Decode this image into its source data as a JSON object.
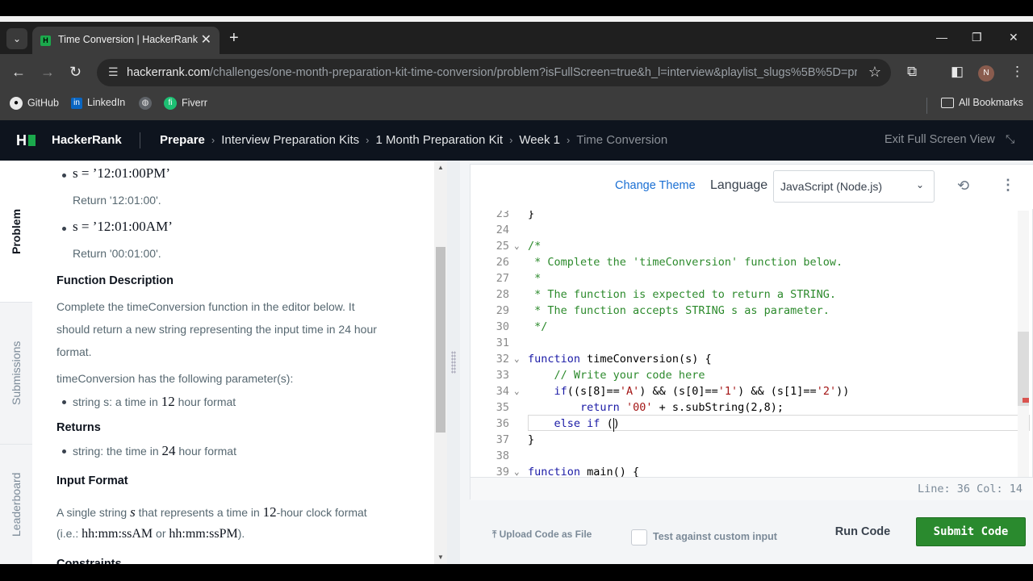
{
  "browser": {
    "tab_title": "Time Conversion | HackerRank",
    "tab_favicon": "H",
    "url_domain": "hackerrank.com",
    "url_path": "/challenges/one-month-preparation-kit-time-conversion/problem?isFullScreen=true&h_l=interview&playlist_slugs%5B%5D=prep...",
    "profile_initial": "N",
    "bookmarks": [
      "GitHub",
      "LinkedIn",
      "",
      "Fiverr"
    ],
    "all_bookmarks": "All Bookmarks"
  },
  "header": {
    "logo": "H",
    "brand": "HackerRank",
    "breadcrumbs": [
      "Prepare",
      "Interview Preparation Kits",
      "1 Month Preparation Kit",
      "Week 1",
      "Time Conversion"
    ],
    "exit_fullscreen": "Exit Full Screen View"
  },
  "side_tabs": [
    "Problem",
    "Submissions",
    "Leaderboard"
  ],
  "problem": {
    "ex1_code": "s = ’12:01:00PM’",
    "ex1_return": "Return '12:01:00'.",
    "ex2_code": "s = ’12:01:00AM’",
    "ex2_return": "Return '00:01:00'.",
    "func_desc_heading": "Function Description",
    "func_desc_line1": "Complete the timeConversion function in the editor below. It",
    "func_desc_line2": "should return a new string representing the input time in 24 hour",
    "func_desc_line3": "format.",
    "params_line": "timeConversion has the following parameter(s):",
    "param_text_a": "string s: a time in ",
    "param_num": "12",
    "param_text_b": " hour format",
    "returns_heading": "Returns",
    "returns_text_a": "string: the time in ",
    "returns_num": "24",
    "returns_text_b": " hour format",
    "input_heading": "Input Format",
    "input_text_a": "A single string ",
    "input_var": "s",
    "input_text_b": " that represents a time in ",
    "input_num": "12",
    "input_text_c": "-hour clock format",
    "ie_open": "(i.e.: ",
    "ie_fmt1": "hh:mm:ssAM",
    "ie_or": " or ",
    "ie_fmt2": "hh:mm:ssPM",
    "ie_close": ").",
    "constraints_heading": "Constraints"
  },
  "editor": {
    "change_theme": "Change Theme",
    "language_label": "Language",
    "language": "JavaScript (Node.js)",
    "status": "Line: 36 Col: 14",
    "lines": [
      {
        "n": "23",
        "text": "}"
      },
      {
        "n": "24",
        "text": ""
      },
      {
        "n": "25",
        "text": "/*"
      },
      {
        "n": "26",
        "text": " * Complete the 'timeConversion' function below."
      },
      {
        "n": "27",
        "text": " *"
      },
      {
        "n": "28",
        "text": " * The function is expected to return a STRING."
      },
      {
        "n": "29",
        "text": " * The function accepts STRING s as parameter."
      },
      {
        "n": "30",
        "text": " */"
      },
      {
        "n": "31",
        "text": ""
      },
      {
        "n": "32",
        "text": "function timeConversion(s) {"
      },
      {
        "n": "33",
        "text": "    // Write your code here"
      },
      {
        "n": "34",
        "text": "    if((s[8]=='A') && (s[0]=='1') && (s[1]=='2'))"
      },
      {
        "n": "35",
        "text": "        return '00' + s.subString(2,8);"
      },
      {
        "n": "36",
        "text": "    else if ()"
      },
      {
        "n": "37",
        "text": "}"
      },
      {
        "n": "38",
        "text": ""
      },
      {
        "n": "39",
        "text": "function main() {"
      }
    ]
  },
  "actions": {
    "upload": "Upload Code as File",
    "custom_input": "Test against custom input",
    "run": "Run Code",
    "submit": "Submit Code"
  },
  "colors": {
    "brand_green": "#1ba94c",
    "submit_green": "#2a8a2e",
    "link_blue": "#1a6fd3",
    "header_bg": "#0e141e"
  }
}
